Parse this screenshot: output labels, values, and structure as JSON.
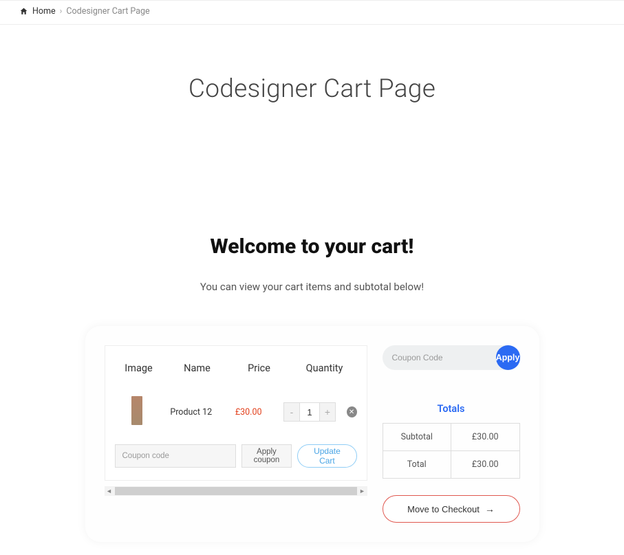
{
  "breadcrumb": {
    "home": "Home",
    "current": "Codesigner Cart Page"
  },
  "page_title": "Codesigner Cart Page",
  "heading": "Welcome to your cart!",
  "subheading": "You can view your cart items and subtotal below!",
  "coupon": {
    "placeholder": "Coupon Code",
    "apply": "Apply"
  },
  "cart": {
    "headers": {
      "image": "Image",
      "name": "Name",
      "price": "Price",
      "quantity": "Quantity"
    },
    "item": {
      "name": "Product 12",
      "price": "£30.00",
      "qty": "1"
    },
    "coupon_placeholder": "Coupon code",
    "apply_coupon": "Apply coupon",
    "update_cart": "Update Cart"
  },
  "totals": {
    "title": "Totals",
    "subtotal_label": "Subtotal",
    "subtotal_value": "£30.00",
    "total_label": "Total",
    "total_value": "£30.00"
  },
  "checkout": {
    "label": "Move to Checkout"
  }
}
